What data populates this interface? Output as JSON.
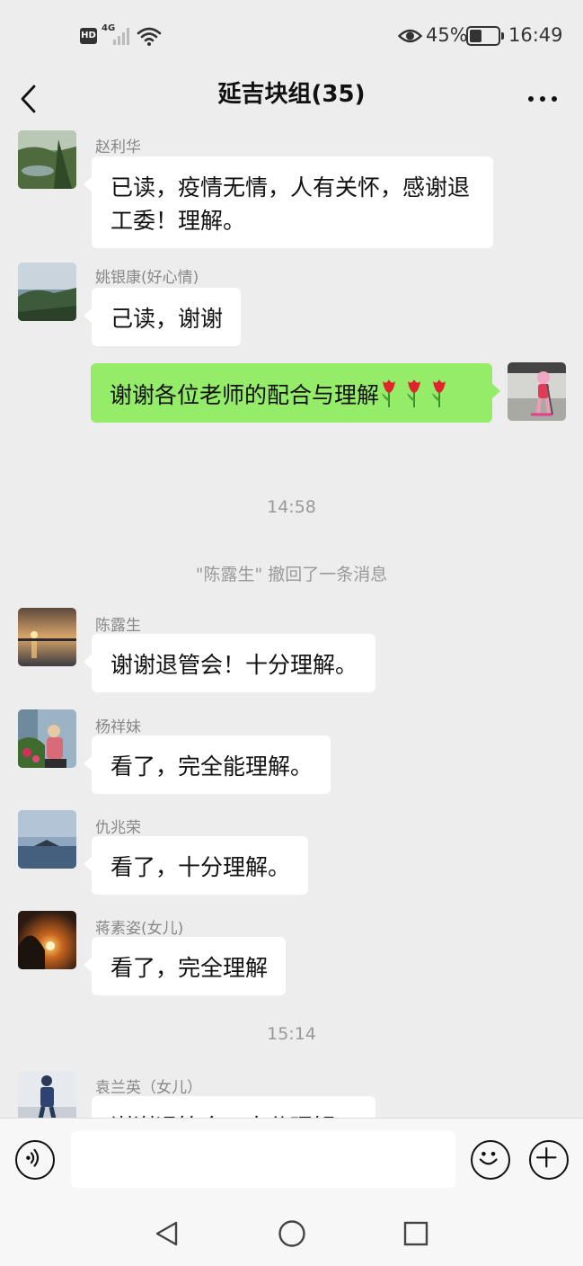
{
  "status_bar": {
    "hd_badge": "HD",
    "network": "4G",
    "battery_percent": "45%",
    "battery_level": 0.45,
    "time": "16:49"
  },
  "header": {
    "title": "延吉块组(35)"
  },
  "messages": [
    {
      "sender": "赵利华",
      "text": "已读，疫情无情，人有关怀，感谢退工委！理解。"
    },
    {
      "sender": "姚银康(好心情)",
      "text": "己读，谢谢"
    },
    {
      "sender": "me",
      "text": "谢谢各位老师的配合与理解",
      "emoji": [
        "tulip",
        "tulip",
        "tulip"
      ]
    },
    {
      "timestamp": "14:58"
    },
    {
      "system": "\"陈露生\" 撤回了一条消息"
    },
    {
      "sender": "陈露生",
      "text": "谢谢退管会！十分理解。"
    },
    {
      "sender": "杨祥妹",
      "text": "看了，完全能理解。"
    },
    {
      "sender": "仇兆荣",
      "text": "看了，十分理解。"
    },
    {
      "sender": "蒋素姿(女儿)",
      "text": "看了，完全理解"
    },
    {
      "timestamp": "15:14"
    },
    {
      "sender": "袁兰英（女儿）",
      "text": "谢谢退管会！十分理解。"
    }
  ],
  "input_bar": {
    "value": "",
    "icons": [
      "voice-icon",
      "emoji-icon",
      "plus-icon"
    ]
  },
  "nav_bar": {
    "icons": [
      "back-triangle-icon",
      "home-circle-icon",
      "recent-square-icon"
    ]
  },
  "colors": {
    "background": "#ededed",
    "self_bubble": "#95ec69",
    "other_bubble": "#ffffff"
  }
}
